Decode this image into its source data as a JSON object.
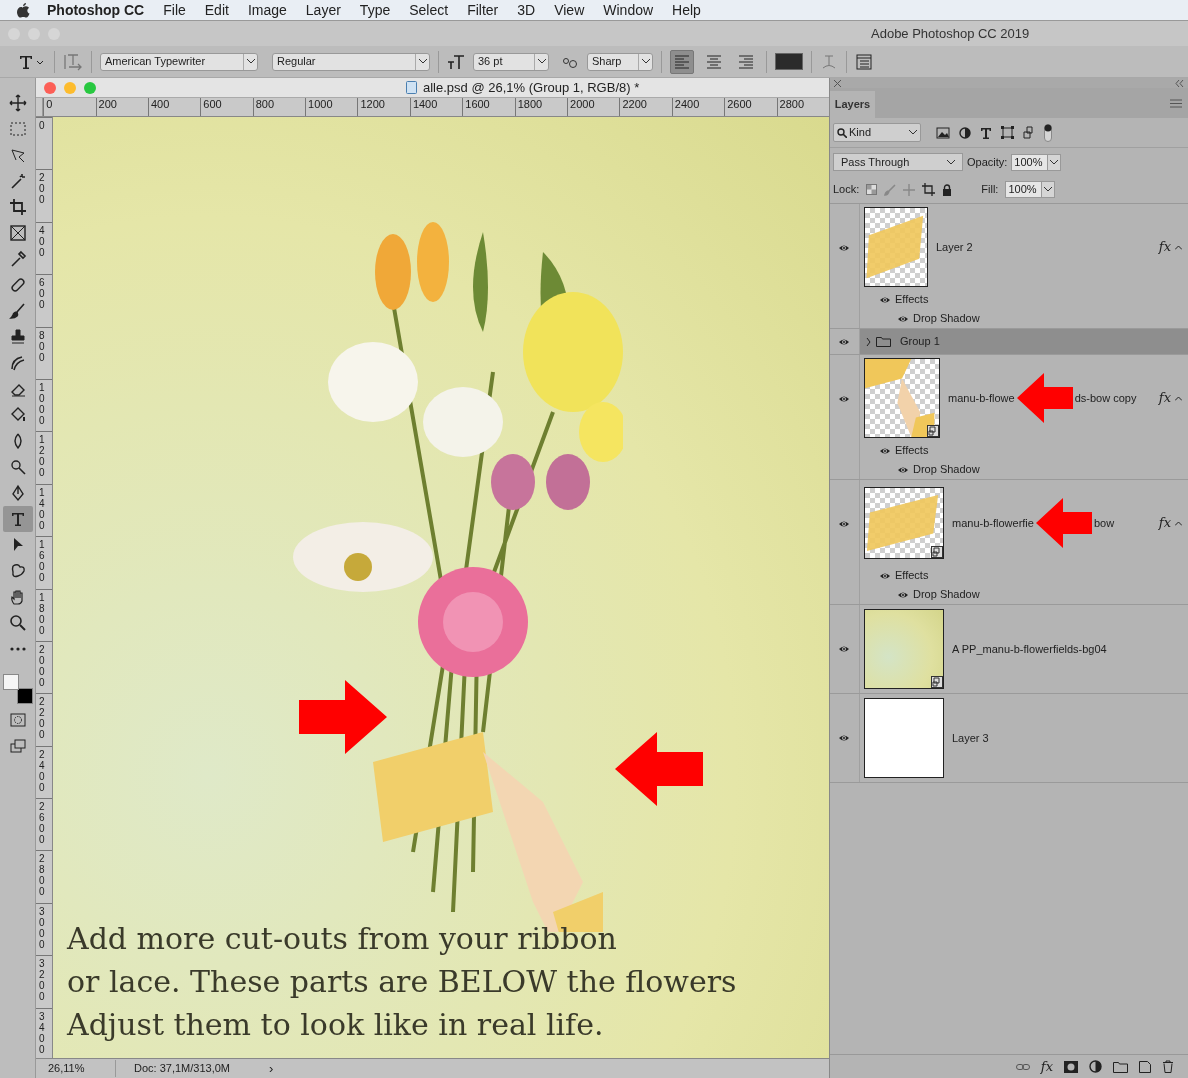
{
  "menu_bar": {
    "app": "Photoshop CC",
    "items": [
      "File",
      "Edit",
      "Image",
      "Layer",
      "Type",
      "Select",
      "Filter",
      "3D",
      "View",
      "Window",
      "Help"
    ]
  },
  "title_bar": {
    "title": "Adobe Photoshop CC 2019"
  },
  "options_bar": {
    "font_family": "American Typewriter",
    "font_style": "Regular",
    "font_size": "36 pt",
    "antialias": "Sharp",
    "align": [
      {
        "kind": "left",
        "selected": true
      },
      {
        "kind": "center",
        "selected": false
      },
      {
        "kind": "right",
        "selected": false
      }
    ]
  },
  "tools": [
    {
      "kind": "move",
      "selected": false
    },
    {
      "kind": "marquee",
      "selected": false
    },
    {
      "kind": "lasso",
      "selected": false
    },
    {
      "kind": "wand",
      "selected": false
    },
    {
      "kind": "crop",
      "selected": false
    },
    {
      "kind": "frame",
      "selected": false
    },
    {
      "kind": "eyedropper",
      "selected": false
    },
    {
      "kind": "healing",
      "selected": false
    },
    {
      "kind": "brush",
      "selected": false
    },
    {
      "kind": "stamp",
      "selected": false
    },
    {
      "kind": "history",
      "selected": false
    },
    {
      "kind": "eraser",
      "selected": false
    },
    {
      "kind": "bucket",
      "selected": false
    },
    {
      "kind": "blur",
      "selected": false
    },
    {
      "kind": "dodge",
      "selected": false
    },
    {
      "kind": "pen",
      "selected": false
    },
    {
      "kind": "type",
      "selected": true
    },
    {
      "kind": "select",
      "selected": false
    },
    {
      "kind": "shape",
      "selected": false
    },
    {
      "kind": "hand",
      "selected": false
    },
    {
      "kind": "zoom",
      "selected": false
    },
    {
      "kind": "more",
      "selected": false
    }
  ],
  "document": {
    "title": "alle.psd @ 26,1% (Group 1, RGB/8) *",
    "ruler_h": [
      "0",
      "200",
      "400",
      "600",
      "800",
      "1000",
      "1200",
      "1400",
      "1600",
      "1800",
      "2000",
      "2200",
      "2400",
      "2600",
      "2800"
    ],
    "ruler_v": [
      "0",
      "200",
      "400",
      "600",
      "800",
      "1000",
      "1200",
      "1400",
      "1600",
      "1800",
      "2000",
      "2200",
      "2400",
      "2600",
      "2800",
      "3000",
      "3200",
      "3400"
    ],
    "canvas_text": [
      "Add more cut-outs from your ribbon",
      "or lace. These parts are BELOW the flowers",
      "Adjust them to look like in real life."
    ],
    "zoom": "26,11%",
    "doc_size": "Doc: 37,1M/313,0M",
    "status_arrow": "›"
  },
  "layers_panel": {
    "tab": "Layers",
    "filter": "Kind",
    "blend_mode": "Pass Through",
    "opacity_label": "Opacity:",
    "opacity": "100%",
    "lock_label": "Lock:",
    "fill_label": "Fill:",
    "fill": "100%",
    "footer_fx": "fx",
    "layers": [
      {
        "kind": "layer",
        "name_parts": [
          "Layer 2"
        ],
        "thumbnail": {
          "kind": "ribbon",
          "smart": false
        },
        "visible": true,
        "selected": false,
        "fx": "fx",
        "effects_label": "Effects",
        "effects": [
          "Drop Shadow"
        ]
      },
      {
        "kind": "group",
        "name_parts": [
          "Group 1"
        ],
        "visible": true,
        "selected": true,
        "expanded": false
      },
      {
        "kind": "layer",
        "name_parts": [
          "manu-b-flowe",
          "ds-bow copy"
        ],
        "thumbnail": {
          "kind": "bow",
          "smart": true
        },
        "visible": true,
        "selected": false,
        "fx": "fx",
        "effects_label": "Effects",
        "effects": [
          "Drop Shadow"
        ]
      },
      {
        "kind": "layer",
        "name_parts": [
          "manu-b-flowerfie",
          "bow"
        ],
        "thumbnail": {
          "kind": "ribbon",
          "smart": true
        },
        "visible": true,
        "selected": false,
        "fx": "fx",
        "effects_label": "Effects",
        "effects": [
          "Drop Shadow"
        ]
      },
      {
        "kind": "layer",
        "name_parts": [
          "A PP_manu-b-flowerfields-bg04"
        ],
        "thumbnail": {
          "kind": "paper",
          "smart": true
        },
        "visible": true,
        "selected": false
      },
      {
        "kind": "layer",
        "name_parts": [
          "Layer 3"
        ],
        "thumbnail": {
          "kind": "white",
          "smart": false
        },
        "visible": true,
        "selected": false
      }
    ]
  }
}
